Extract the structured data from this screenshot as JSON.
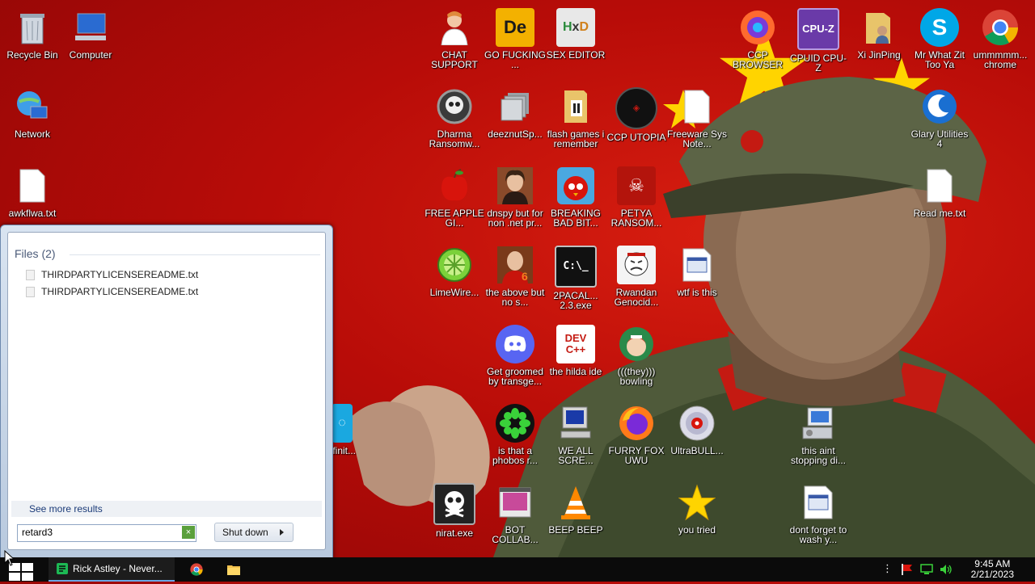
{
  "desktop": {
    "icons": [
      {
        "label": "Recycle Bin",
        "icon": "recycle-bin-icon"
      },
      {
        "label": "Computer",
        "icon": "computer-icon"
      },
      {
        "label": "Network",
        "icon": "network-icon"
      },
      {
        "label": "awkflwa.txt",
        "icon": "text-file-icon"
      },
      {
        "label": "CHAT SUPPORT",
        "icon": "doctor-icon"
      },
      {
        "label": "GO FUCKING ...",
        "icon": "de-app-icon"
      },
      {
        "label": "SEX EDITOR",
        "icon": "hxd-icon"
      },
      {
        "label": "CCP BROWSER",
        "icon": "firefox-style-icon"
      },
      {
        "label": "CPUID CPU-Z",
        "icon": "cpu-z-icon"
      },
      {
        "label": "Xi JinPing",
        "icon": "user-folder-icon"
      },
      {
        "label": "Mr What Zit Too Ya",
        "icon": "skype-icon"
      },
      {
        "label": "ummmmm... chrome",
        "icon": "chrome-icon"
      },
      {
        "label": "Dharma Ransomw...",
        "icon": "skull-icon"
      },
      {
        "label": "deeznutSp...",
        "icon": "shortcut-icon"
      },
      {
        "label": "flash games i remember",
        "icon": "folder-icon"
      },
      {
        "label": "CCP UTOPIA",
        "icon": "ccp-utopia-icon"
      },
      {
        "label": "Freeware Sys Note...",
        "icon": "text-file-icon"
      },
      {
        "label": "Glary Utilities 4",
        "icon": "glary-icon"
      },
      {
        "label": "FREE APPLE GI...",
        "icon": "apple-icon"
      },
      {
        "label": "dnspy but for non .net pr...",
        "icon": "portrait-icon"
      },
      {
        "label": "BREAKING BAD BIT...",
        "icon": "angry-bird-icon"
      },
      {
        "label": "PETYA RANSOM...",
        "icon": "petya-skull-icon"
      },
      {
        "label": "Read me.txt",
        "icon": "text-file-icon"
      },
      {
        "label": "LimeWire...",
        "icon": "limewire-icon"
      },
      {
        "label": "the above but no s...",
        "icon": "portrait-icon"
      },
      {
        "label": "2PACAL... 2.3.exe",
        "icon": "console-icon"
      },
      {
        "label": "Rwandan Genocid...",
        "icon": "meme-icon"
      },
      {
        "label": "wtf is this",
        "icon": "window-file-icon"
      },
      {
        "label": "Get groomed by transge...",
        "icon": "discord-icon"
      },
      {
        "label": "the hilda ide",
        "icon": "dev-cpp-icon"
      },
      {
        "label": "(((they))) bowling",
        "icon": "bowling-icon"
      },
      {
        "label": "is that a phobos r...",
        "icon": "icq-icon"
      },
      {
        "label": "WE ALL SCRE...",
        "icon": "pc-icon"
      },
      {
        "label": "FURRY FOX UWU",
        "icon": "firefox-icon"
      },
      {
        "label": "UltraBULL...",
        "icon": "disc-icon"
      },
      {
        "label": "this aint stopping di...",
        "icon": "installer-icon"
      },
      {
        "label": "infinit...",
        "icon": "partial-app-icon"
      },
      {
        "label": "nirat.exe",
        "icon": "skull-white-icon"
      },
      {
        "label": "BOT COLLAB...",
        "icon": "film-icon"
      },
      {
        "label": "BEEP BEEP",
        "icon": "vlc-icon"
      },
      {
        "label": "you tried",
        "icon": "star-icon"
      },
      {
        "label": "dont forget to wash y...",
        "icon": "window-file-icon"
      }
    ]
  },
  "start_menu": {
    "files_header": "Files (2)",
    "files": [
      "THIRDPARTYLICENSEREADME.txt",
      "THIRDPARTYLICENSEREADME.txt"
    ],
    "see_more": "See more results",
    "search_value": "retard3",
    "clear_glyph": "×",
    "shutdown_label": "Shut down"
  },
  "taskbar": {
    "active_window": "Rick Astley - Never...",
    "pinned": [
      "chrome-icon",
      "folder-icon"
    ],
    "tray_icons": [
      "overflow-icon",
      "flag-icon",
      "network-icon",
      "volume-icon"
    ],
    "time": "9:45 AM",
    "date": "2/21/2023"
  },
  "colors": {
    "wallpaper_red": "#c8140c",
    "star_yellow": "#ffd400",
    "taskbar": "#0b0b0b"
  }
}
